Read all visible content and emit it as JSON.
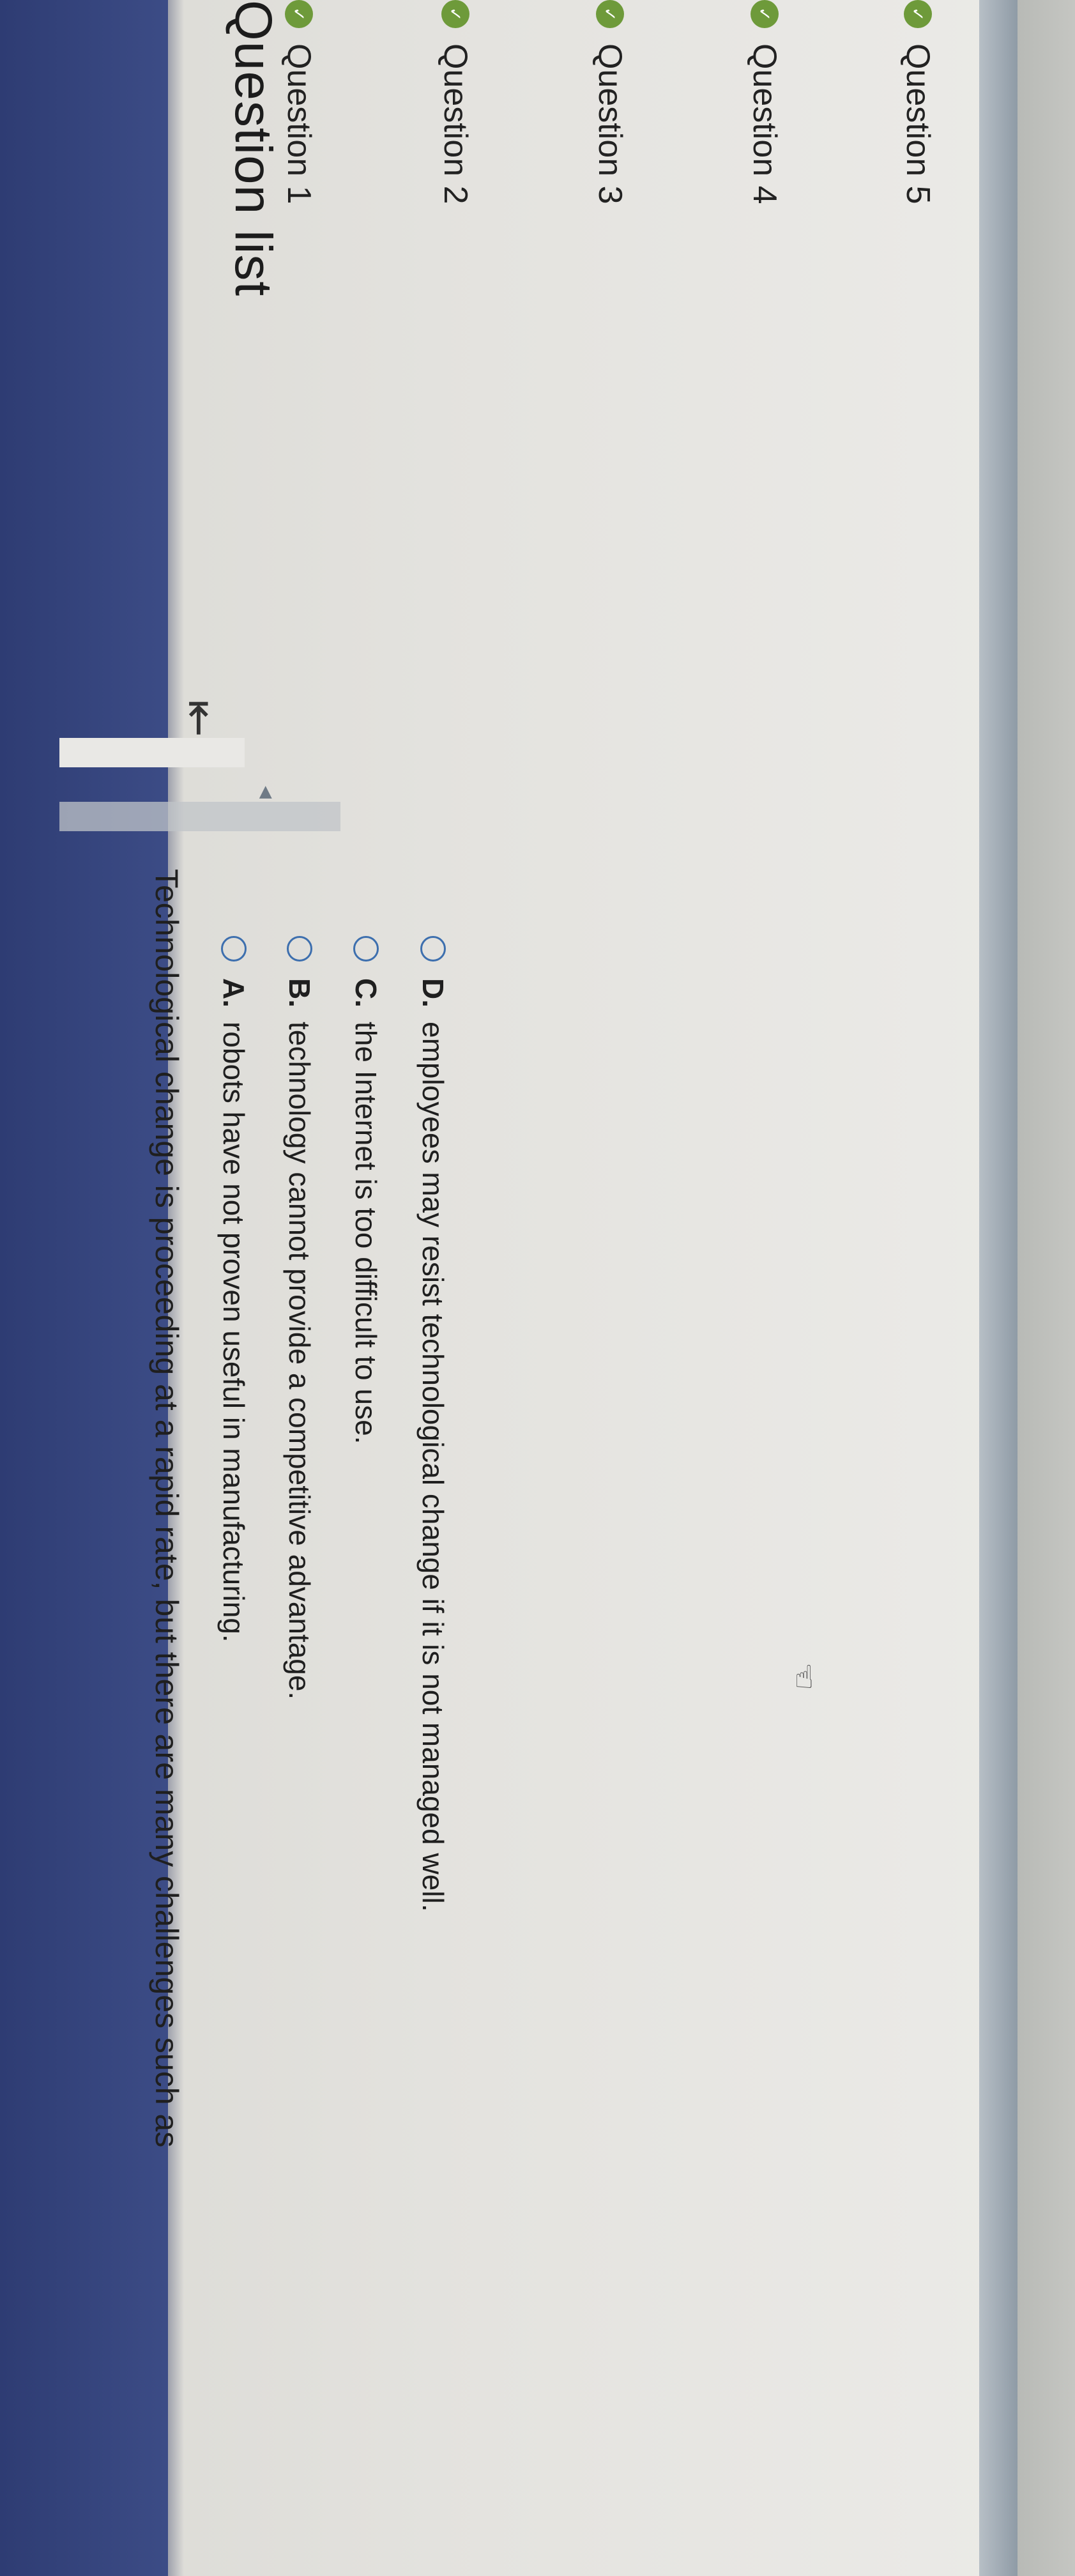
{
  "sidebar": {
    "title": "Question list",
    "items": [
      {
        "label": "Question 1",
        "done": true
      },
      {
        "label": "Question 2",
        "done": true
      },
      {
        "label": "Question 3",
        "done": true
      },
      {
        "label": "Question 4",
        "done": true
      },
      {
        "label": "Question 5",
        "done": true
      }
    ],
    "check_symbol": "✓"
  },
  "collapse_icon": "⇤",
  "question": {
    "prompt": "Technological change is proceeding at a rapid rate, but there are many challenges such as",
    "options": [
      {
        "letter": "A.",
        "text": "robots have not proven useful in manufacturing."
      },
      {
        "letter": "B.",
        "text": "technology cannot provide a competitive advantage."
      },
      {
        "letter": "C.",
        "text": "the Internet is too difficult to use."
      },
      {
        "letter": "D.",
        "text": "employees may resist technological change if it is not managed well."
      }
    ]
  },
  "colors": {
    "topbar": "#2e3c73",
    "check": "#6e9a3a",
    "radio": "#3d6fae"
  }
}
